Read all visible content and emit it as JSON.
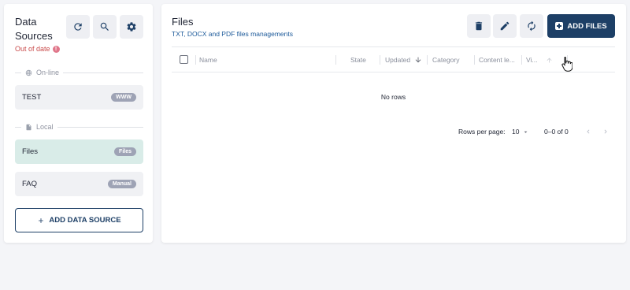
{
  "sidebar": {
    "title": "Data Sources",
    "status": "Out of date",
    "status_icon": "!",
    "sections": {
      "online": "On-line",
      "local": "Local"
    },
    "items": [
      {
        "label": "TEST",
        "badge": "WWW"
      },
      {
        "label": "Files",
        "badge": "Files"
      },
      {
        "label": "FAQ",
        "badge": "Manual"
      }
    ],
    "add_button": "ADD DATA SOURCE",
    "toolbar_icons": [
      "refresh-icon",
      "search-icon",
      "gear-icon"
    ]
  },
  "main": {
    "title": "Files",
    "subtitle": "TXT, DOCX and PDF files managements",
    "add_files_button": "ADD FILES",
    "toolbar_icons": [
      "trash-icon",
      "pencil-icon",
      "refresh-icon"
    ],
    "table": {
      "columns": [
        "Name",
        "State",
        "Updated",
        "Category",
        "Content le...",
        "Vi..."
      ],
      "empty_text": "No rows"
    },
    "pagination": {
      "rows_per_page_label": "Rows per page:",
      "rows_per_page_value": "10",
      "range": "0–0 of 0"
    }
  },
  "colors": {
    "accent": "#1d3f66",
    "active_item": "#d9ece8",
    "status_red": "#c94b4b",
    "badge_gray": "#9ea3b5"
  }
}
